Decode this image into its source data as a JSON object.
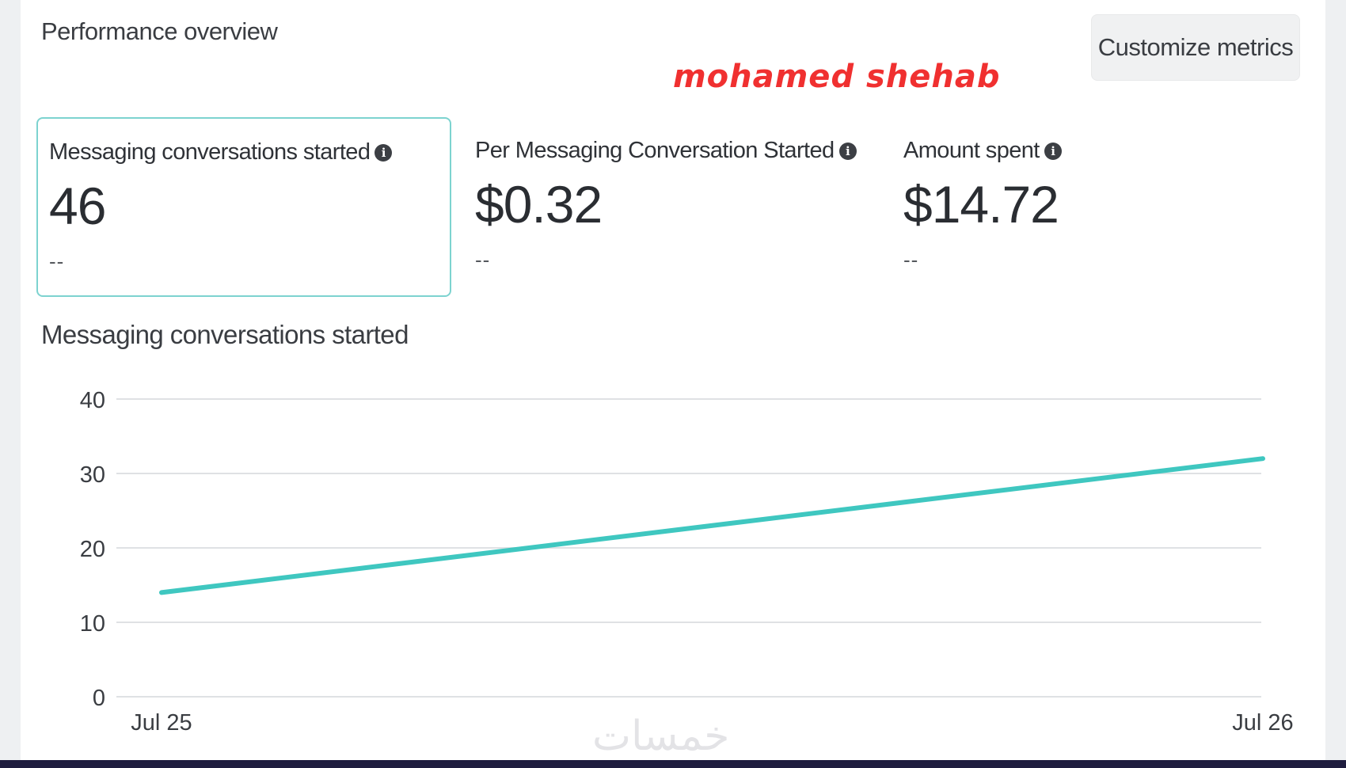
{
  "header": {
    "title": "Performance overview",
    "customize_label": "Customize metrics",
    "watermark": "mohamed shehab"
  },
  "metrics": [
    {
      "label": "Messaging conversations started",
      "value": "46",
      "delta": "--"
    },
    {
      "label": "Per Messaging Conversation Started",
      "value": "$0.32",
      "delta": "--"
    },
    {
      "label": "Amount spent",
      "value": "$14.72",
      "delta": "--"
    }
  ],
  "chart_title": "Messaging conversations started",
  "chart_data": {
    "type": "line",
    "x": [
      "Jul 25",
      "Jul 26"
    ],
    "series": [
      {
        "values": [
          14,
          32
        ],
        "color": "#3fc7c0"
      }
    ],
    "ylim": [
      0,
      40
    ],
    "yticks": [
      "0",
      "10",
      "20",
      "30",
      "40"
    ],
    "grid": true,
    "xlabel": "",
    "ylabel": ""
  },
  "footer_logo": "خمسات"
}
